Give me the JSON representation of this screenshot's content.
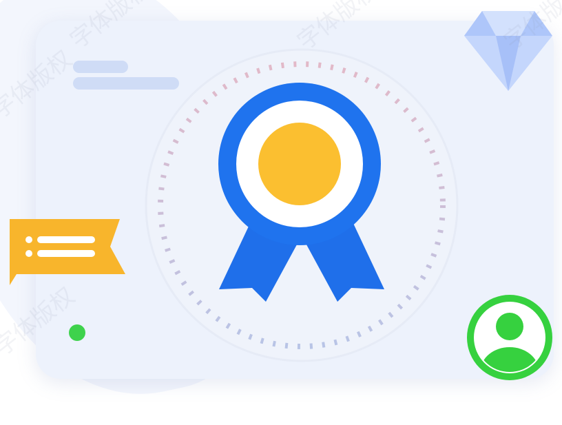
{
  "illustration": {
    "description_icons": [
      "diamond-icon",
      "award-ribbon-icon",
      "list-flag-icon",
      "user-avatar-icon",
      "status-dot"
    ],
    "colors": {
      "card_background": "#edf2fc",
      "ribbon_blue": "#1f73ee",
      "medal_gold": "#fbbf30",
      "medal_ring": "#ffffff",
      "flag_yellow": "#f8b52c",
      "avatar_green": "#36d13f",
      "diamond_blue": "#b9cdfb",
      "placeholder_line": "#cfdcf6",
      "dial_tick": "#c9c3da"
    },
    "watermark_text": "字体版权"
  }
}
